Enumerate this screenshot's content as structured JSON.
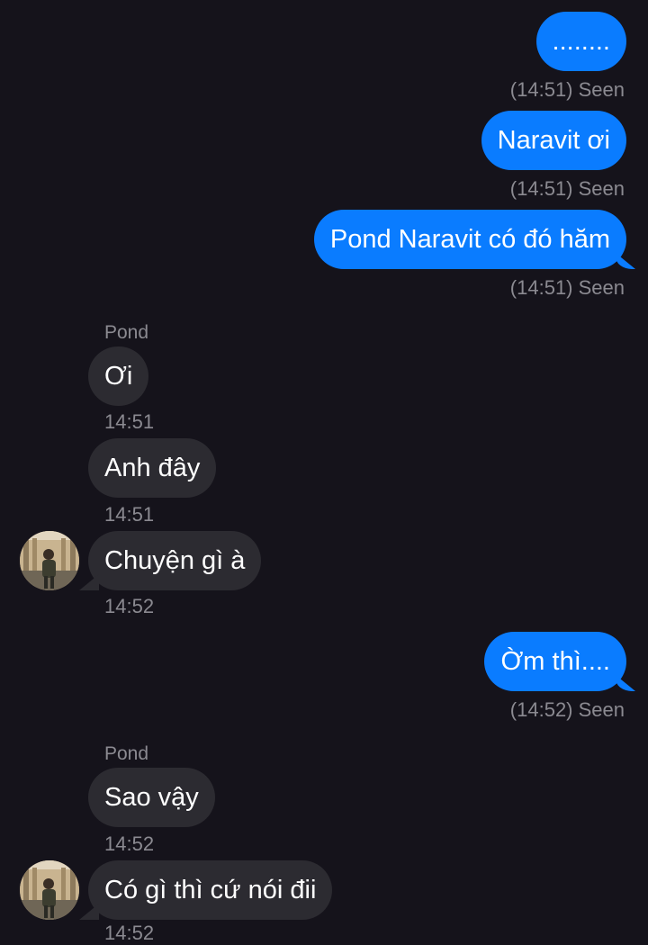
{
  "conversation": {
    "messages": [
      {
        "direction": "outgoing",
        "text": "........",
        "status": "(14:51) Seen"
      },
      {
        "direction": "outgoing",
        "text": "Naravit ơi",
        "status": "(14:51) Seen"
      },
      {
        "direction": "outgoing",
        "text": "Pond Naravit có đó hăm",
        "status": "(14:51) Seen"
      },
      {
        "direction": "incoming",
        "sender": "Pond",
        "text": "Ơi",
        "time": "14:51"
      },
      {
        "direction": "incoming",
        "text": "Anh đây",
        "time": "14:51"
      },
      {
        "direction": "incoming",
        "text": "Chuyện gì à",
        "time": "14:52"
      },
      {
        "direction": "outgoing",
        "text": "Ờm thì....",
        "status": "(14:52) Seen"
      },
      {
        "direction": "incoming",
        "sender": "Pond",
        "text": "Sao vậy",
        "time": "14:52"
      },
      {
        "direction": "incoming",
        "text": "Có gì thì cứ nói đii",
        "time": "14:52"
      }
    ]
  },
  "colors": {
    "background": "#15131b",
    "outgoing_bubble": "#0a7cff",
    "incoming_bubble": "#2c2b31",
    "meta_text": "#8b8a91"
  },
  "avatar": {
    "icon": "profile-photo-avatar"
  }
}
